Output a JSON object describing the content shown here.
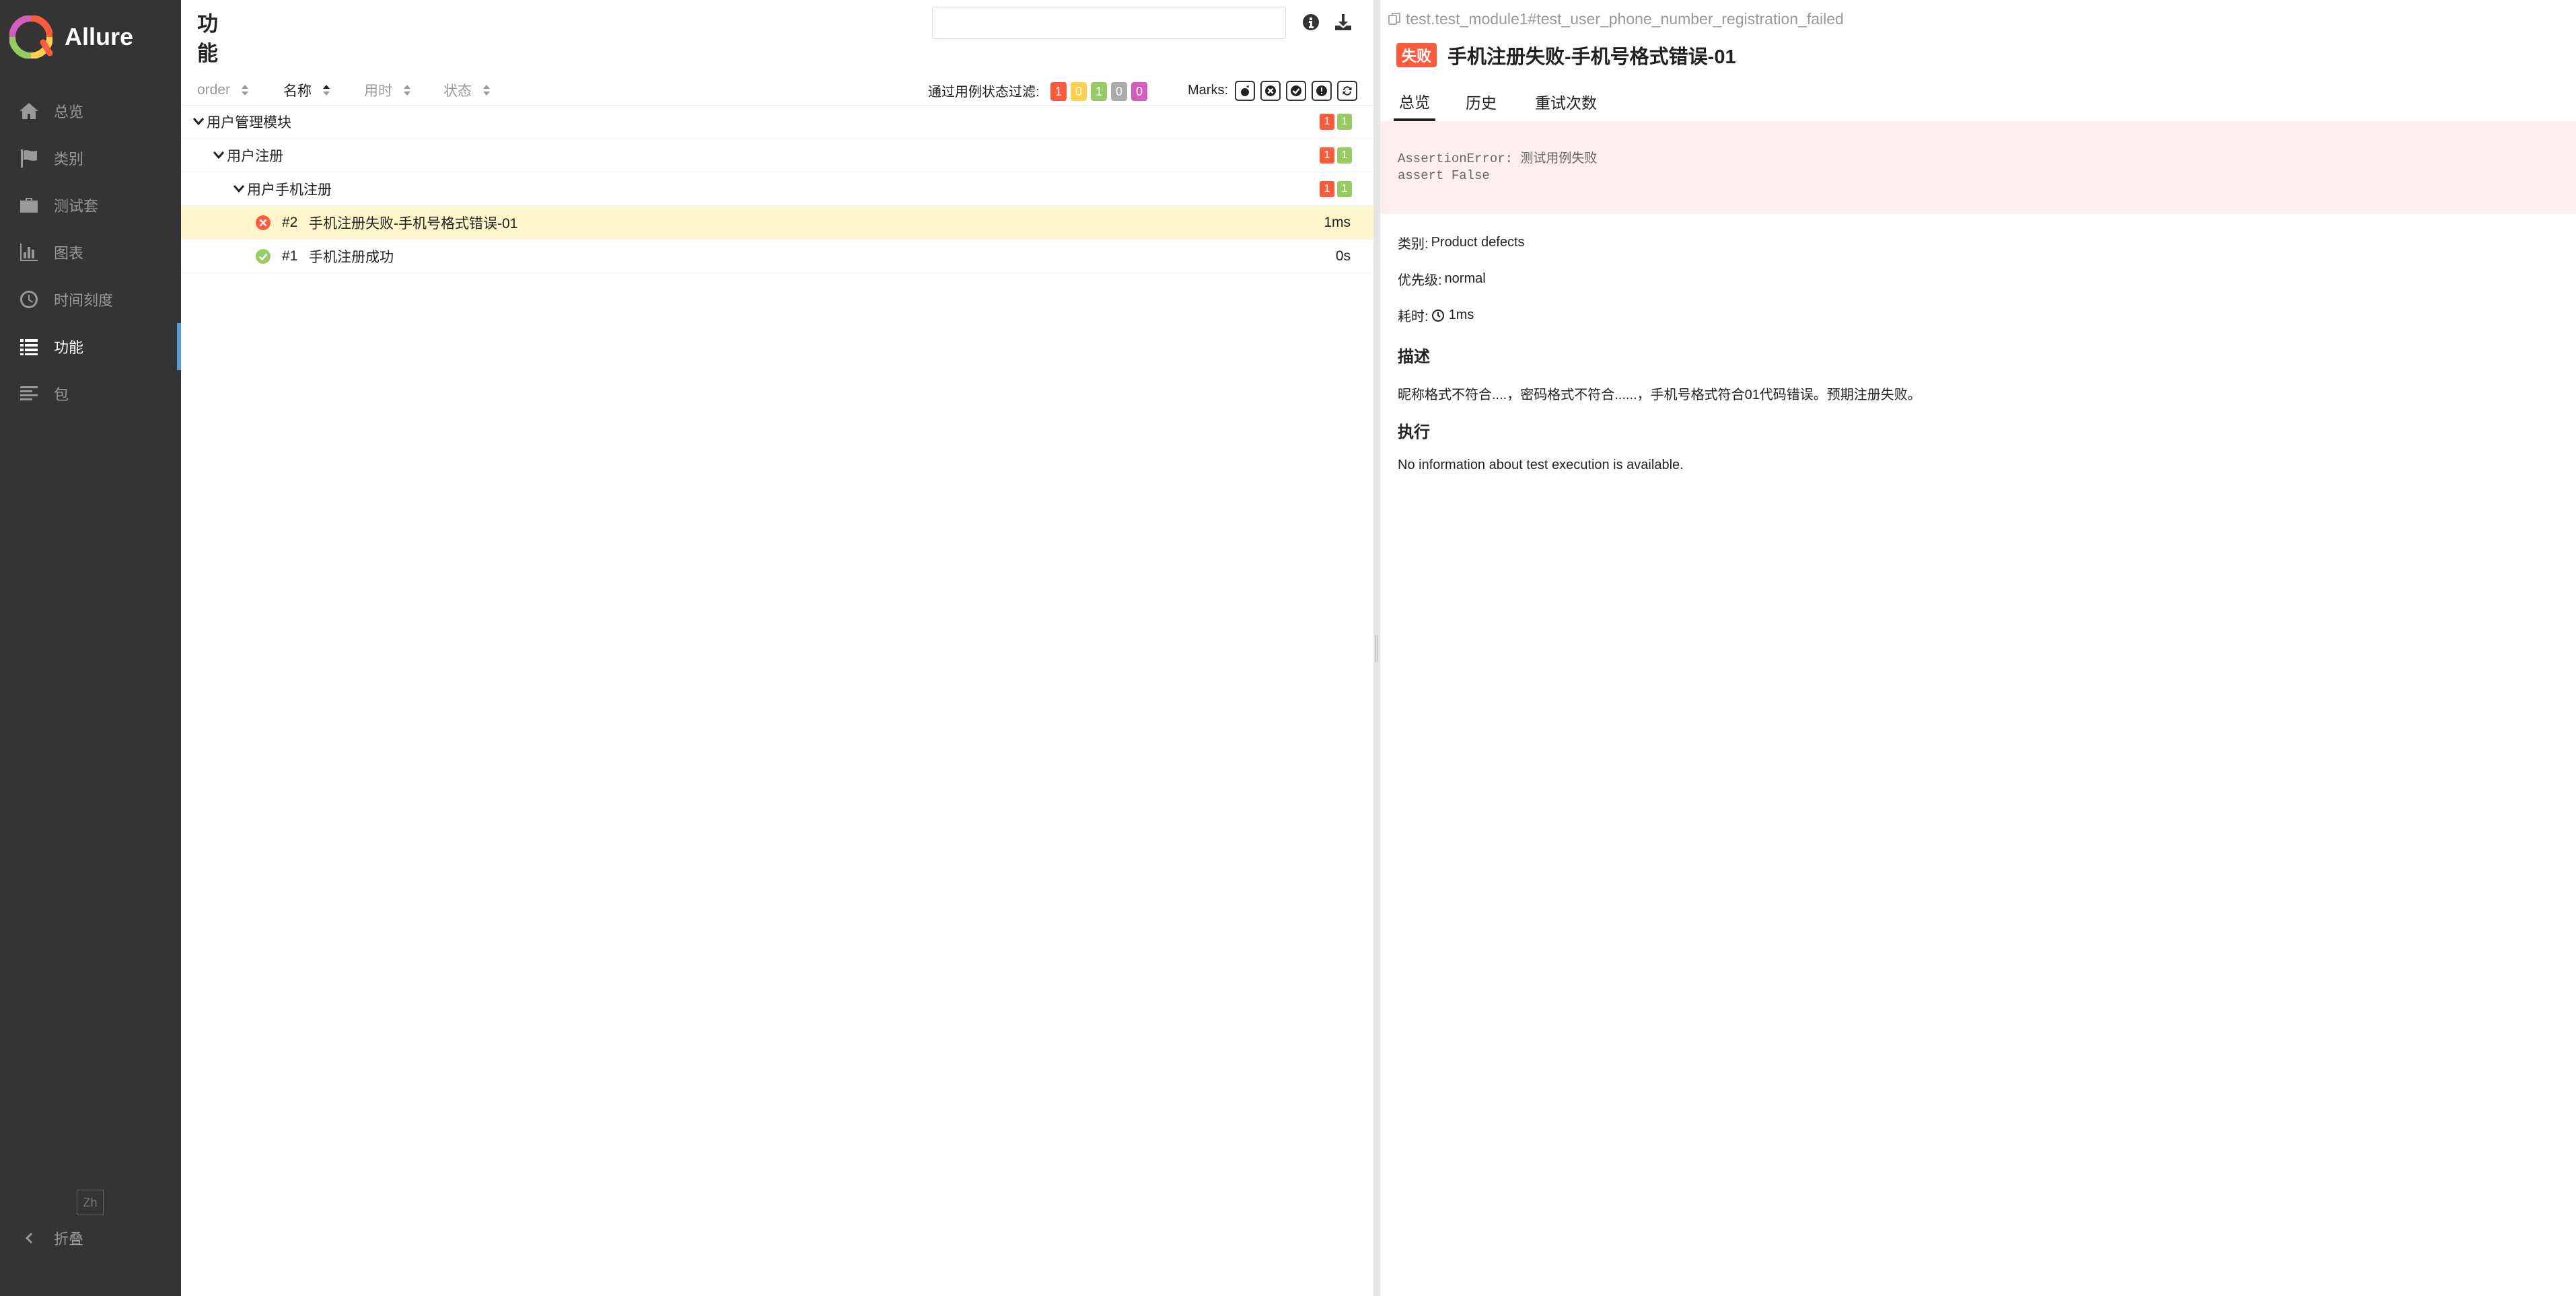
{
  "app": {
    "name": "Allure"
  },
  "sidebar": {
    "items": [
      {
        "label": "总览",
        "icon": "home-icon"
      },
      {
        "label": "类别",
        "icon": "flag-icon"
      },
      {
        "label": "测试套",
        "icon": "briefcase-icon"
      },
      {
        "label": "图表",
        "icon": "bar-chart-icon"
      },
      {
        "label": "时间刻度",
        "icon": "clock-icon"
      },
      {
        "label": "功能",
        "icon": "list-icon",
        "active": true
      },
      {
        "label": "包",
        "icon": "align-left-icon"
      }
    ],
    "language": "Zh",
    "collapse_label": "折叠"
  },
  "tree_pane": {
    "title": "功能",
    "search": {
      "value": "",
      "placeholder": ""
    },
    "sort_columns": [
      {
        "label": "order",
        "active": false
      },
      {
        "label": "名称",
        "active": true
      },
      {
        "label": "用时",
        "active": false
      },
      {
        "label": "状态",
        "active": false
      }
    ],
    "filter_label": "通过用例状态过滤:",
    "status_filters": [
      {
        "value": "1",
        "status": "failed",
        "color": "#fd5a3e"
      },
      {
        "value": "0",
        "status": "broken",
        "color": "#ffd050"
      },
      {
        "value": "1",
        "status": "passed",
        "color": "#97cc64"
      },
      {
        "value": "0",
        "status": "skipped",
        "color": "#aaaaaa"
      },
      {
        "value": "0",
        "status": "unknown",
        "color": "#d35ebe"
      }
    ],
    "marks_label": "Marks:",
    "marks": [
      "flaky-icon",
      "new-failed-icon",
      "new-passed-icon",
      "new-broken-icon",
      "retries-icon"
    ],
    "groups": [
      {
        "name": "用户管理模块",
        "failed": "1",
        "passed": "1"
      },
      {
        "name": "用户注册",
        "failed": "1",
        "passed": "1"
      },
      {
        "name": "用户手机注册",
        "failed": "1",
        "passed": "1"
      }
    ],
    "tests": [
      {
        "order": "#2",
        "name": "手机注册失败-手机号格式错误-01",
        "duration": "1ms",
        "status": "failed",
        "selected": true
      },
      {
        "order": "#1",
        "name": "手机注册成功",
        "duration": "0s",
        "status": "passed",
        "selected": false
      }
    ]
  },
  "details": {
    "full_name": "test.test_module1#test_user_phone_number_registration_failed",
    "status_label": "失败",
    "title": "手机注册失败-手机号格式错误-01",
    "tabs": [
      "总览",
      "历史",
      "重试次数"
    ],
    "error_message": "AssertionError: 测试用例失败\nassert False",
    "category_label": "类别:",
    "category_value": "Product defects",
    "severity_label": "优先级:",
    "severity_value": "normal",
    "duration_label": "耗时:",
    "duration_value": "1ms",
    "description_heading": "描述",
    "description_text": "昵称格式不符合....，密码格式不符合......，手机号格式符合01代码错误。预期注册失败。",
    "execution_heading": "执行",
    "execution_text": "No information about test execution is available."
  }
}
